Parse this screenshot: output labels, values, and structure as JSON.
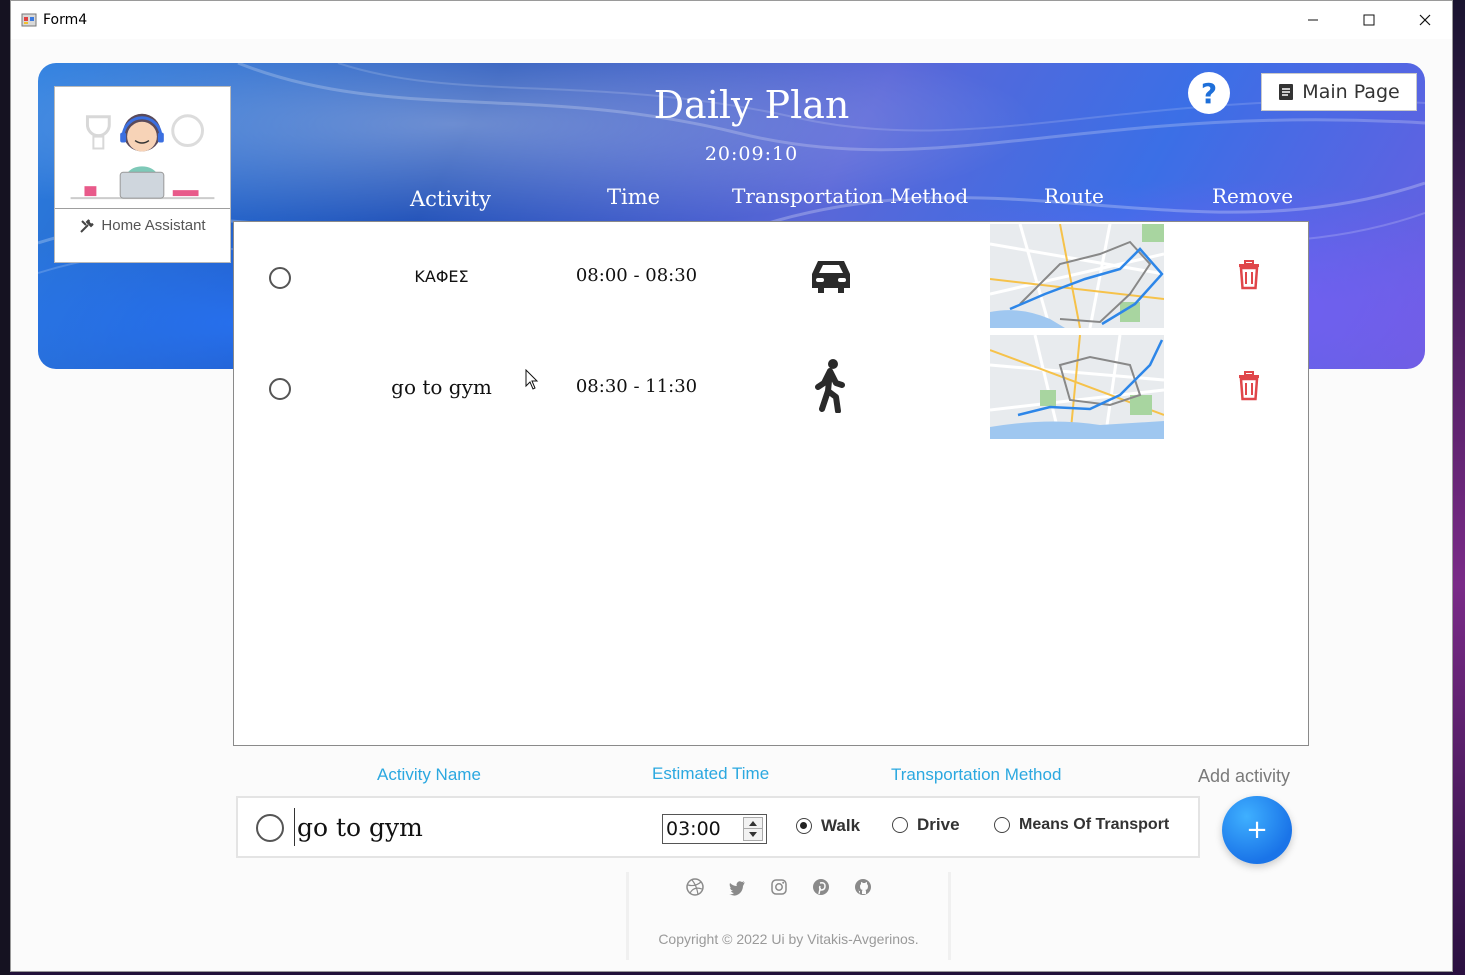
{
  "window": {
    "title": "Form4"
  },
  "header": {
    "title": "Daily Plan",
    "clock": "20:09:10",
    "help_icon": "question-icon",
    "main_page_label": "Main Page"
  },
  "assistant": {
    "label": "Home Assistant"
  },
  "columns": {
    "activity": "Activity",
    "time": "Time",
    "transport": "Transportation Method",
    "route": "Route",
    "remove": "Remove"
  },
  "activities": [
    {
      "name": "ΚΑΦΕΣ",
      "time": "08:00 - 08:30",
      "transport_icon": "car-icon"
    },
    {
      "name": "go to gym",
      "time": "08:30 - 11:30",
      "transport_icon": "walking-person-icon"
    }
  ],
  "form": {
    "activity_name_label": "Activity Name",
    "estimated_time_label": "Estimated Time",
    "transport_label": "Transportation Method",
    "add_label": "Add activity",
    "name_value": "go to gym",
    "time_value": "03:00",
    "options": [
      "Walk",
      "Drive",
      "Means Of Transport"
    ],
    "selected_option": "Walk",
    "add_button": "+"
  },
  "footer": {
    "social_icons": [
      "dribbble-icon",
      "twitter-icon",
      "instagram-icon",
      "pinterest-icon",
      "github-icon"
    ],
    "copyright": "Copyright © 2022 Ui by Vitakis-Avgerinos."
  },
  "colors": {
    "accent": "#2ba8e0",
    "add_button": "#1a74e8",
    "trash": "#e0464a"
  }
}
